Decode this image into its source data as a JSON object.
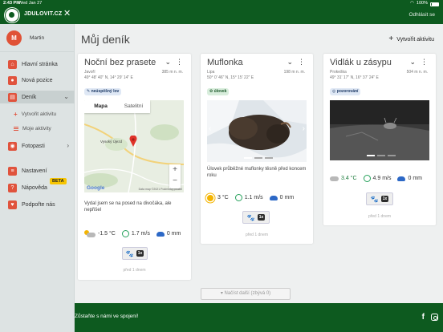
{
  "status_bar": {
    "time": "2:43 PM",
    "date": "Wed Jan 27",
    "battery": "100%"
  },
  "app": {
    "brand": "JDULOVIT.CZ",
    "logout": "Odhlásit se"
  },
  "sidebar": {
    "user": {
      "initial": "M",
      "name": "Martin"
    },
    "items": [
      {
        "label": "Hlavní stránka",
        "icon": "home-icon",
        "glyph": "⌂"
      },
      {
        "label": "Nová pozice",
        "icon": "pin-icon",
        "glyph": "●"
      },
      {
        "label": "Deník",
        "icon": "book-icon",
        "glyph": "▤"
      },
      {
        "label": "Fotopasti",
        "icon": "camera-icon",
        "glyph": "◉"
      },
      {
        "label": "Nastavení",
        "icon": "settings-icon",
        "glyph": "≡"
      },
      {
        "label": "Nápověda",
        "icon": "help-icon",
        "glyph": "?"
      },
      {
        "label": "Podpořte nás",
        "icon": "heart-icon",
        "glyph": "♥"
      }
    ],
    "sub_items": [
      {
        "label": "Vytvořit aktivitu"
      },
      {
        "label": "Moje aktivity"
      }
    ],
    "beta": "BETA"
  },
  "main": {
    "title": "Můj deník",
    "create_label": "Vytvořit aktivitu",
    "load_more": "▾ Načíst další (zbývá 0)"
  },
  "cards": [
    {
      "title": "Noční bez prasete",
      "location": "Javoří",
      "coords": "49° 48' 40\" N, 14° 29' 14\" E",
      "altitude": "385 m n. m.",
      "tag": "neúspěšný lov",
      "map": {
        "tab_map": "Mapa",
        "tab_sat": "Satelitní",
        "place": "Vysoký Újezd",
        "credit": "Data map ©2021  Podmínky použití",
        "google": "Google"
      },
      "note": "Vydal jsem se na posed na divočáka, ale nepřišel",
      "weather": {
        "temp": "-1.5 °C",
        "wind": "1.7 m/s",
        "rain": "0 mm",
        "sky": "partly-cloudy"
      },
      "count": "1x",
      "footnote": "před 1 dnem"
    },
    {
      "title": "Muflonka",
      "location": "Lipa",
      "coords": "50° 0' 46\" N, 15° 15' 22\" E",
      "altitude": "198 m n. m.",
      "tag": "úlovek",
      "note": "Úlovek průběžné muflonky těsně před koncem roku",
      "weather": {
        "temp": "3 °C",
        "wind": "1.1 m/s",
        "rain": "0 mm",
        "sky": "sunny"
      },
      "count": "1x",
      "footnote": "před 1 dnem"
    },
    {
      "title": "Vidlák u zásypu",
      "location": "Prokeška",
      "coords": "49° 31' 17\" N, 16° 37' 24\" E",
      "altitude": "504 m n. m.",
      "tag": "pozorování",
      "weather": {
        "temp": "3.4 °C",
        "wind": "4.9 m/s",
        "rain": "0 mm",
        "sky": "cloudy"
      },
      "count": "1x",
      "footnote": "před 1 dnem"
    }
  ],
  "footer": {
    "text": "Zůstaňte s námi ve spojení!",
    "fb": "f"
  },
  "colors": {
    "brand_green": "#0d5a1f",
    "accent_red": "#e0533d",
    "beta_yellow": "#f7c500"
  }
}
